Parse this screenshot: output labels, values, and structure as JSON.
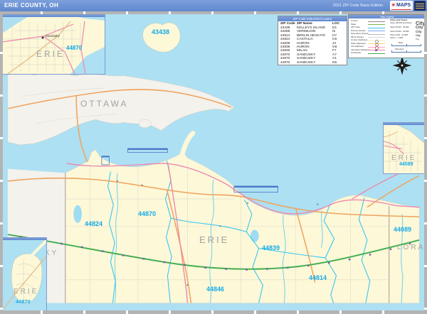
{
  "header": {
    "title": "ERIE COUNTY, OH",
    "edition": "2021 ZIP Code Basic Edition",
    "logo": {
      "brand": "MAPS"
    }
  },
  "zip_table": {
    "title": "ZIP Code Index/Grid Locator",
    "columns": [
      "ZIP Code",
      "ZIP Name",
      "LOC"
    ],
    "rows": [
      [
        "43438",
        "KELLEYS ISLAND",
        "D1"
      ],
      [
        "44089",
        "VERMILION",
        "I5"
      ],
      [
        "44814",
        "BERLIN HEIGHTS",
        "H7"
      ],
      [
        "44824",
        "CASTALIA",
        "C6"
      ],
      [
        "44839",
        "HURON",
        "J4"
      ],
      [
        "44839",
        "HURON",
        "G6"
      ],
      [
        "44846",
        "MILAN",
        "F7"
      ],
      [
        "44870",
        "SANDUSKY",
        "A7"
      ],
      [
        "44870",
        "SANDUSKY",
        "A1"
      ],
      [
        "44870",
        "SANDUSKY",
        "D5"
      ]
    ]
  },
  "legend": {
    "title": "Map Legend",
    "line_items": [
      {
        "label": "County",
        "color": "#8c8c8c"
      },
      {
        "label": "State",
        "color": "#7ab648"
      },
      {
        "label": "ZIP Code",
        "color": "#35c4f0"
      },
      {
        "label": "Primary Streets",
        "color": "#7aa7e8"
      },
      {
        "label": "Secondary Streets",
        "color": "#b8b8b8"
      },
      {
        "label": "Minor Streets",
        "color": "#d9d9d9"
      },
      {
        "label": "County Highways",
        "color": "#f2edc4"
      },
      {
        "label": "State Highways",
        "color": "#f7d871"
      },
      {
        "label": "US Highways",
        "color": "#f4a0c4"
      },
      {
        "label": "Interstate Highways",
        "color": "#ef7f9e"
      },
      {
        "label": "Toll Roads",
        "color": "#41ad4f"
      }
    ],
    "cities": {
      "title": "Cities and Towns",
      "rows": [
        {
          "label": "Cities 100,000 and Above",
          "sample": "City"
        },
        {
          "label": "Cities 50,000 - 99,999",
          "sample": "City"
        },
        {
          "label": "Cities 25,000 - 49,999",
          "sample": "City"
        },
        {
          "label": "Cities 5,000 - 24,999",
          "sample": "City"
        },
        {
          "label": "Cities 1 - 4,999",
          "sample": "City"
        }
      ]
    },
    "scale": {
      "miles": "Miles",
      "kilometers": "Kilometers"
    }
  },
  "map": {
    "county_labels": [
      {
        "text": "OTTAWA"
      },
      {
        "text": "ERIE"
      },
      {
        "text": "LORAIN"
      },
      {
        "text": "KY"
      }
    ],
    "zip_labels": [
      {
        "text": "43438"
      },
      {
        "text": "44870"
      },
      {
        "text": "44824"
      },
      {
        "text": "44839"
      },
      {
        "text": "44846"
      },
      {
        "text": "44814"
      },
      {
        "text": "44089"
      }
    ],
    "insets": [
      {
        "county": "ERIE",
        "zip": "44870",
        "city": "Sandusky"
      },
      {
        "county": "ERIE",
        "zip": "44089"
      },
      {
        "county": "ERIE",
        "zip": "44870"
      }
    ]
  },
  "colors": {
    "title_bar": "#6d94d6",
    "water": "#ade0f2",
    "zip_land": "#fcf8d8",
    "adjacent_land": "#f3f2ec",
    "zip_boundary": "#35c4f0",
    "zip_label": "#17abe8",
    "county_label": "#a3a3a3",
    "major_road": "#f0a35e",
    "us_highway": "#ee86ad",
    "toll_road": "#41ad4f",
    "interstate_marker": "#7e5fa8"
  }
}
